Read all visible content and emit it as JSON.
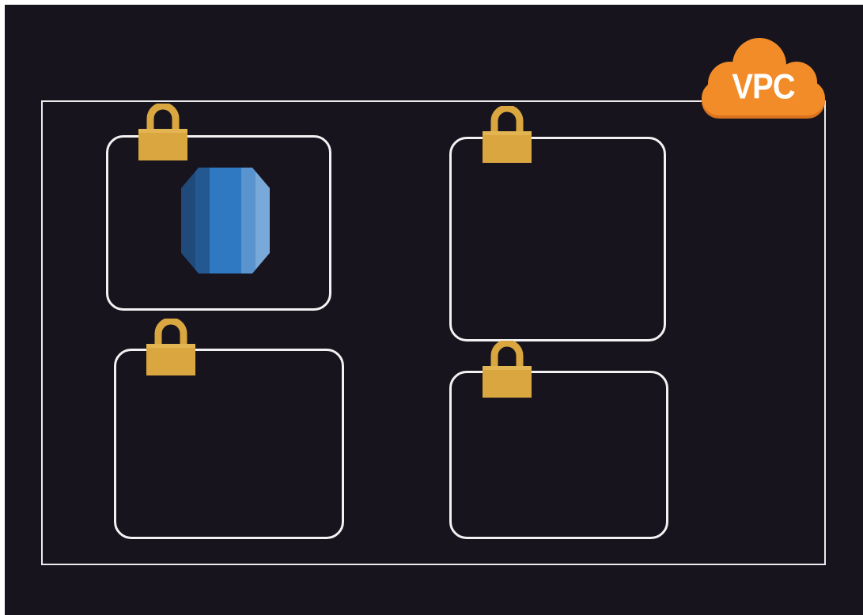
{
  "vpc": {
    "label": "VPC",
    "color": "#f28c28",
    "icon": "vpc-cloud-icon"
  },
  "subnets": [
    {
      "name": "subnet-top-left",
      "icon": "lock-icon",
      "contains": "database-icon"
    },
    {
      "name": "subnet-top-right",
      "icon": "lock-icon"
    },
    {
      "name": "subnet-bottom-left",
      "icon": "lock-icon"
    },
    {
      "name": "subnet-bottom-right",
      "icon": "lock-icon"
    }
  ],
  "colors": {
    "background": "#17141d",
    "frame": "#ececec",
    "lock": "#d9a63f",
    "database": "#2e73b8"
  }
}
